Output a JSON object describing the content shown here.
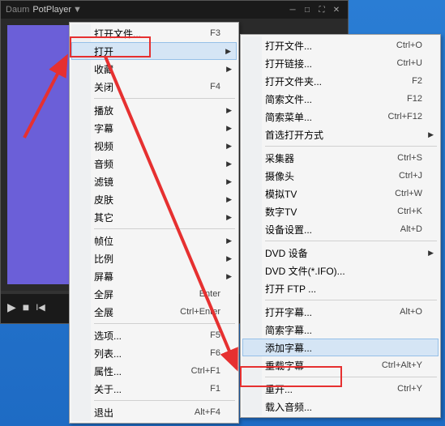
{
  "titlebar": {
    "app_prefix": "Daum",
    "app_name": "PotPlayer"
  },
  "menu1": {
    "items": [
      {
        "label": "打开文件...",
        "shortcut": "F3",
        "arrow": false
      },
      {
        "label": "打开",
        "shortcut": "",
        "arrow": true,
        "hover": true
      },
      {
        "label": "收藏",
        "shortcut": "",
        "arrow": true
      },
      {
        "label": "关闭",
        "shortcut": "F4",
        "arrow": false
      },
      {
        "sep": true
      },
      {
        "label": "播放",
        "shortcut": "",
        "arrow": true
      },
      {
        "label": "字幕",
        "shortcut": "",
        "arrow": true
      },
      {
        "label": "视频",
        "shortcut": "",
        "arrow": true
      },
      {
        "label": "音频",
        "shortcut": "",
        "arrow": true
      },
      {
        "label": "滤镜",
        "shortcut": "",
        "arrow": true
      },
      {
        "label": "皮肤",
        "shortcut": "",
        "arrow": true
      },
      {
        "label": "其它",
        "shortcut": "",
        "arrow": true
      },
      {
        "sep": true
      },
      {
        "label": "帧位",
        "shortcut": "",
        "arrow": true
      },
      {
        "label": "比例",
        "shortcut": "",
        "arrow": true
      },
      {
        "label": "屏幕",
        "shortcut": "",
        "arrow": true
      },
      {
        "label": "全屏",
        "shortcut": "Enter",
        "arrow": false
      },
      {
        "label": "全展",
        "shortcut": "Ctrl+Enter",
        "arrow": false
      },
      {
        "sep": true
      },
      {
        "label": "选项...",
        "shortcut": "F5",
        "arrow": false
      },
      {
        "label": "列表...",
        "shortcut": "F6",
        "arrow": false
      },
      {
        "label": "属性...",
        "shortcut": "Ctrl+F1",
        "arrow": false
      },
      {
        "label": "关于...",
        "shortcut": "F1",
        "arrow": false
      },
      {
        "sep": true
      },
      {
        "label": "退出",
        "shortcut": "Alt+F4",
        "arrow": false
      }
    ]
  },
  "menu2": {
    "items": [
      {
        "label": "打开文件...",
        "shortcut": "Ctrl+O"
      },
      {
        "label": "打开链接...",
        "shortcut": "Ctrl+U"
      },
      {
        "label": "打开文件夹...",
        "shortcut": "F2"
      },
      {
        "label": "简索文件...",
        "shortcut": "F12"
      },
      {
        "label": "简索菜单...",
        "shortcut": "Ctrl+F12"
      },
      {
        "label": "首选打开方式",
        "shortcut": "",
        "arrow": true
      },
      {
        "sep": true
      },
      {
        "label": "采集器",
        "shortcut": "Ctrl+S"
      },
      {
        "label": "摄像头",
        "shortcut": "Ctrl+J"
      },
      {
        "label": "模拟TV",
        "shortcut": "Ctrl+W"
      },
      {
        "label": "数字TV",
        "shortcut": "Ctrl+K"
      },
      {
        "label": "设备设置...",
        "shortcut": "Alt+D"
      },
      {
        "sep": true
      },
      {
        "label": "DVD 设备",
        "shortcut": "",
        "arrow": true
      },
      {
        "label": "DVD 文件(*.IFO)...",
        "shortcut": ""
      },
      {
        "label": "打开 FTP ...",
        "shortcut": ""
      },
      {
        "sep": true
      },
      {
        "label": "打开字幕...",
        "shortcut": "Alt+O"
      },
      {
        "label": "简索字幕...",
        "shortcut": ""
      },
      {
        "label": "添加字幕...",
        "shortcut": "",
        "hover": true
      },
      {
        "label": "重载字幕",
        "shortcut": "Ctrl+Alt+Y"
      },
      {
        "sep": true
      },
      {
        "label": "重开...",
        "shortcut": "Ctrl+Y"
      },
      {
        "label": "载入音频...",
        "shortcut": ""
      }
    ]
  }
}
